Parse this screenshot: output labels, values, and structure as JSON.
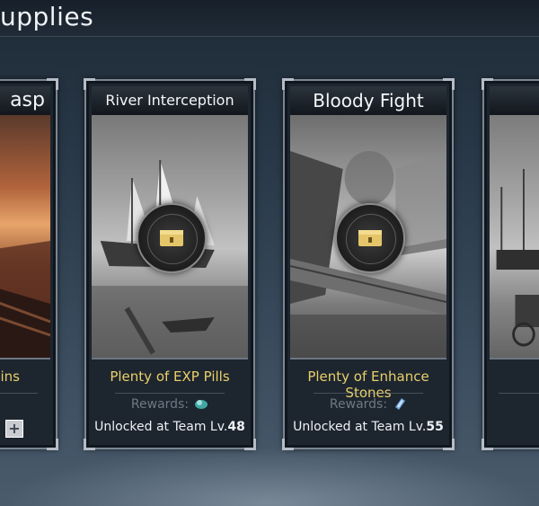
{
  "header": {
    "title_fragment": "upplies"
  },
  "cards": [
    {
      "title": "asp",
      "name": "ins",
      "locked": false
    },
    {
      "title": "River Interception",
      "name": "Plenty of EXP Pills",
      "rewards_label": "Rewards:",
      "reward_icon": "exp-pill-icon",
      "unlock_prefix": "Unlocked at Team Lv.",
      "unlock_level": "48",
      "locked": true
    },
    {
      "title": "Bloody Fight",
      "name": "Plenty of Enhance Stones",
      "rewards_label": "Rewards:",
      "reward_icon": "enhance-stone-icon",
      "unlock_prefix": "Unlocked at Team Lv.",
      "unlock_level": "55",
      "locked": true
    },
    {
      "title": "",
      "name": "",
      "locked": true
    }
  ],
  "colors": {
    "name_text": "#e9d06a",
    "rewards_text": "#6f7983",
    "unlock_text": "#eef1f4",
    "card_border": "#7c8692"
  },
  "plus_label": "+"
}
